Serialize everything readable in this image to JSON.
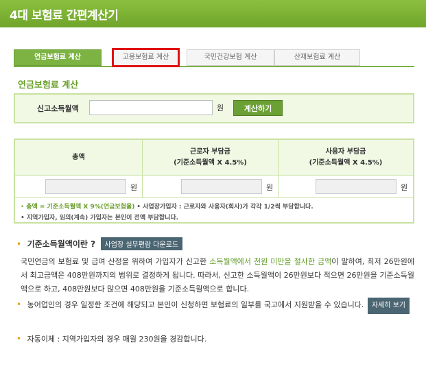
{
  "header": {
    "title": "4대 보험료 간편계산기",
    "bg_color": "#7cb342"
  },
  "tabs": [
    {
      "label": "연금보험료 계산",
      "active": true
    },
    {
      "label": "고용보험료 계산",
      "highlighted": true
    },
    {
      "label": "국민건강보험 계산"
    },
    {
      "label": "산재보험료 계산"
    }
  ],
  "section_title": "연금보험료 계산",
  "input": {
    "label": "신고소득월액",
    "value": "",
    "unit": "원",
    "button": "계산하기"
  },
  "result": {
    "columns": [
      {
        "title": "총액",
        "sub": ""
      },
      {
        "title": "근로자 부담금",
        "sub": "(기준소득월액 X 4.5%)"
      },
      {
        "title": "사용자 부담금",
        "sub": "(기준소득월액 X 4.5%)"
      }
    ],
    "unit": "원",
    "note1_bullet": "•",
    "note1_green": "총액 = 기준소득월액 X 9%(연금보험율)",
    "note1_rest": "• 사업장가입자 : 근로자와 사용자(회사)가 각각 1/2씩 부담합니다.",
    "note2": "• 지역가입자, 임의(계속) 가입자는 본인이 전액 부담합니다."
  },
  "info": {
    "bullet": "•",
    "title": "기준소득월액이란 ?",
    "download_button": "사업장 실무편람 다운로드",
    "para_1": "국민연금의 보험료 및 급여 산정을 위하여 가입자가 신고한 ",
    "para_green": "소득월액에서 천원 미만을 절사한 금액",
    "para_2": "이 말하여, 최저 26만원에서 최고금액은 408만원까지의 범위로 결정하게 됩니다. 따라서, 신고한 소득월액이 26만원보다 적으면 26만원을 기준소득월액으로 하고, 408만원보다 많으면 408만원을 기준소득월액으로 합니다.",
    "farmer_text": "농어업인의 경우 일정한 조건에 해당되고 본인이 신청하면 보험료의 일부를 국고에서 지원받을 수 있습니다.",
    "detail_button": "자세히 보기",
    "auto_transfer": "자동이체 : 지역가입자의 경우 매월 230원을 경감합니다."
  }
}
